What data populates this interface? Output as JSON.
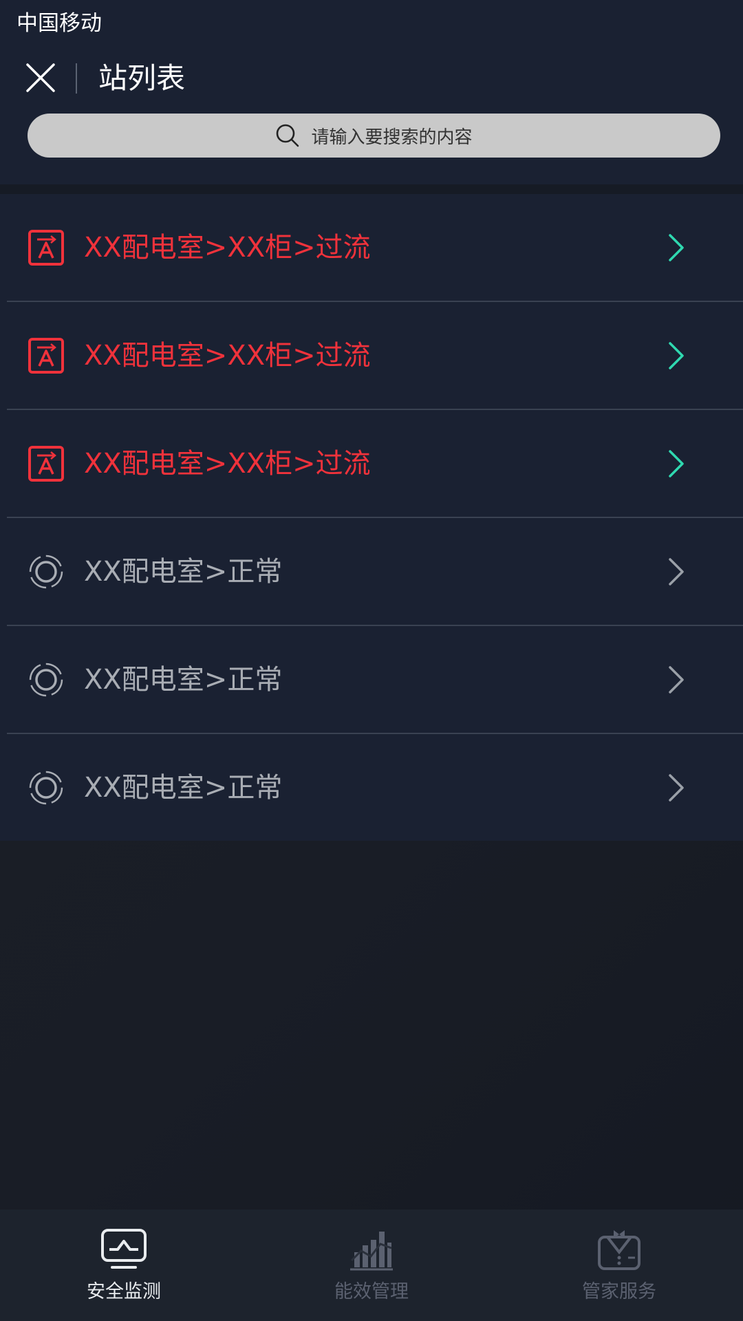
{
  "status_bar": {
    "carrier": "中国移动"
  },
  "header": {
    "title": "站列表",
    "close_icon": "close-icon"
  },
  "search": {
    "placeholder": "请输入要搜索的内容",
    "icon": "search-icon"
  },
  "colors": {
    "alarm": "#f0323b",
    "normal": "#a9adb4",
    "chevron_alarm": "#2fd9b0",
    "chevron_normal": "#9aa0a8",
    "background": "#1a2132"
  },
  "stations": [
    {
      "label": "XX配电室>XX柜>过流",
      "status": "alarm",
      "icon": "alarm-icon"
    },
    {
      "label": "XX配电室>XX柜>过流",
      "status": "alarm",
      "icon": "alarm-icon"
    },
    {
      "label": "XX配电室>XX柜>过流",
      "status": "alarm",
      "icon": "alarm-icon"
    },
    {
      "label": "XX配电室>正常",
      "status": "normal",
      "icon": "normal-ring-icon"
    },
    {
      "label": "XX配电室>正常",
      "status": "normal",
      "icon": "normal-ring-icon"
    },
    {
      "label": "XX配电室>正常",
      "status": "normal",
      "icon": "normal-ring-icon"
    }
  ],
  "tabs": [
    {
      "label": "安全监测",
      "icon": "monitor-icon",
      "active": true
    },
    {
      "label": "能效管理",
      "icon": "bar-chart-icon",
      "active": false
    },
    {
      "label": "管家服务",
      "icon": "butler-icon",
      "active": false
    }
  ]
}
